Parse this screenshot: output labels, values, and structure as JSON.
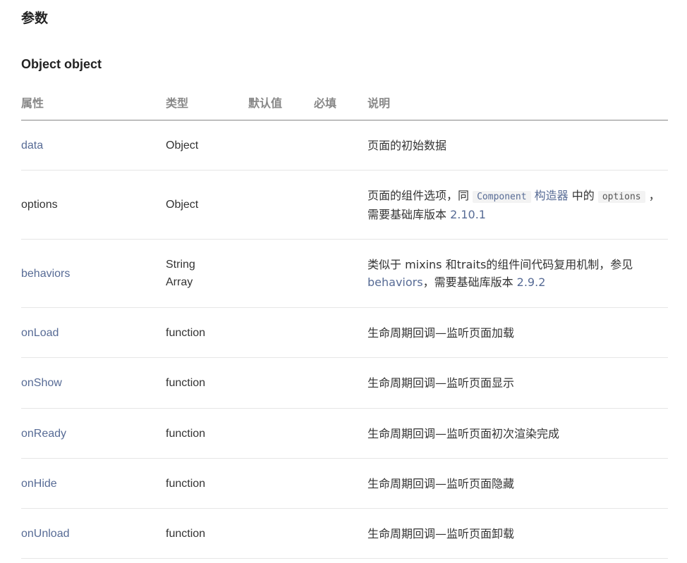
{
  "section_title": "参数",
  "object_title": "Object object",
  "table": {
    "headers": {
      "property": "属性",
      "type": "类型",
      "default": "默认值",
      "required": "必填",
      "description": "说明"
    },
    "rows": [
      {
        "property": "data",
        "type_lines": [
          "Object"
        ],
        "default": "",
        "required": "",
        "desc_parts": [
          {
            "text": "页面的初始数据",
            "kind": "text"
          }
        ]
      },
      {
        "property": "options",
        "type_lines": [
          "Object"
        ],
        "default": "",
        "required": "",
        "desc_parts": [
          {
            "text": "页面的组件选项，同 ",
            "kind": "text"
          },
          {
            "text": "Component",
            "kind": "code-link"
          },
          {
            "text": " 构造器",
            "kind": "link"
          },
          {
            "text": " 中的 ",
            "kind": "text"
          },
          {
            "text": "options",
            "kind": "code"
          },
          {
            "text": " ，需要基础库版本 ",
            "kind": "text"
          },
          {
            "text": "2.10.1",
            "kind": "link"
          }
        ]
      },
      {
        "property": "behaviors",
        "type_lines": [
          "String",
          "Array"
        ],
        "default": "",
        "required": "",
        "desc_parts": [
          {
            "text": "类似于 mixins 和traits的组件间代码复用机制，参见 ",
            "kind": "text"
          },
          {
            "text": "behaviors",
            "kind": "link"
          },
          {
            "text": "，需要基础库版本 ",
            "kind": "text"
          },
          {
            "text": "2.9.2",
            "kind": "link"
          }
        ]
      },
      {
        "property": "onLoad",
        "type_lines": [
          "function"
        ],
        "default": "",
        "required": "",
        "desc_parts": [
          {
            "text": "生命周期回调—监听页面加载",
            "kind": "text"
          }
        ]
      },
      {
        "property": "onShow",
        "type_lines": [
          "function"
        ],
        "default": "",
        "required": "",
        "desc_parts": [
          {
            "text": "生命周期回调—监听页面显示",
            "kind": "text"
          }
        ]
      },
      {
        "property": "onReady",
        "type_lines": [
          "function"
        ],
        "default": "",
        "required": "",
        "desc_parts": [
          {
            "text": "生命周期回调—监听页面初次渲染完成",
            "kind": "text"
          }
        ]
      },
      {
        "property": "onHide",
        "type_lines": [
          "function"
        ],
        "default": "",
        "required": "",
        "desc_parts": [
          {
            "text": "生命周期回调—监听页面隐藏",
            "kind": "text"
          }
        ]
      },
      {
        "property": "onUnload",
        "type_lines": [
          "function"
        ],
        "default": "",
        "required": "",
        "desc_parts": [
          {
            "text": "生命周期回调—监听页面卸载",
            "kind": "text"
          }
        ]
      }
    ]
  },
  "colors": {
    "link": "#576b95",
    "text": "#333333",
    "header": "#888888",
    "divider": "#e6e6e6"
  }
}
